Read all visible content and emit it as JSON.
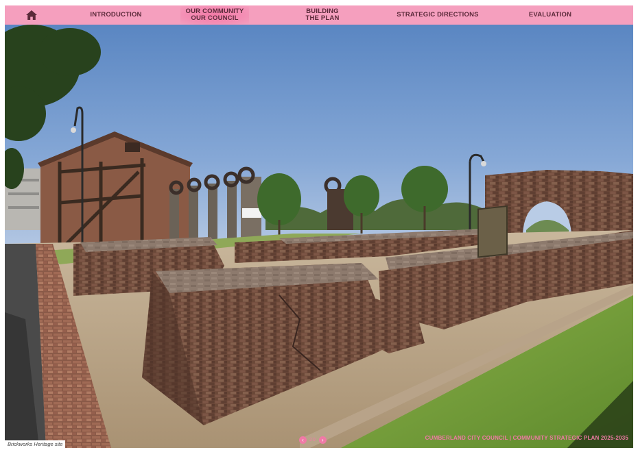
{
  "nav": {
    "home_icon": "home-icon",
    "items": [
      {
        "line1": "INTRODUCTION",
        "line2": ""
      },
      {
        "line1": "OUR COMMUNITY",
        "line2": "OUR COUNCIL"
      },
      {
        "line1": "BUILDING",
        "line2": "THE PLAN"
      },
      {
        "line1": "STRATEGIC DIRECTIONS",
        "line2": ""
      },
      {
        "line1": "EVALUATION",
        "line2": ""
      }
    ],
    "active_index": 1
  },
  "photo": {
    "caption": "Brickworks Heritage site"
  },
  "footer": {
    "page_number": "20",
    "prev_icon": "chevron-left-icon",
    "next_icon": "chevron-right-icon",
    "document_title": "CUMBERLAND CITY COUNCIL | COMMUNITY STRATEGIC PLAN 2025-2035"
  },
  "colors": {
    "nav_background": "#f59fbe",
    "nav_text": "#5b2a3a",
    "accent_pink": "#f07aa6"
  }
}
